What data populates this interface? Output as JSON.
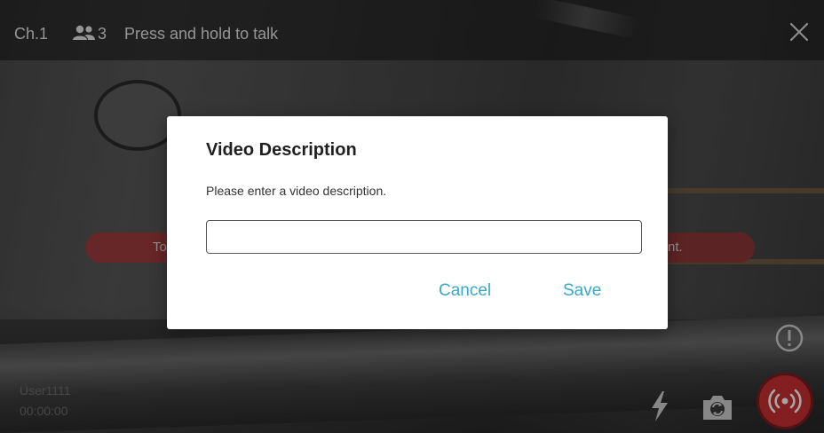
{
  "top_bar": {
    "channel": "Ch.1",
    "member_count": "3",
    "hint": "Press and hold to talk",
    "members_icon": "members-icon",
    "close_icon": "close-icon"
  },
  "background_banners": {
    "left_text": "To",
    "right_text": "nt."
  },
  "bottom": {
    "user": "User1111",
    "time": "00:00:00",
    "flash_icon": "flash-icon",
    "camera_switch_icon": "camera-switch-icon",
    "live_icon": "live-broadcast-icon",
    "alert_icon": "alert-icon"
  },
  "dialog": {
    "title": "Video Description",
    "message": "Please enter a video description.",
    "input_value": "",
    "cancel_label": "Cancel",
    "save_label": "Save"
  },
  "colors": {
    "accent": "#3aa8c4",
    "live_red": "#c93032",
    "banner_red": "#9e3b3c"
  }
}
